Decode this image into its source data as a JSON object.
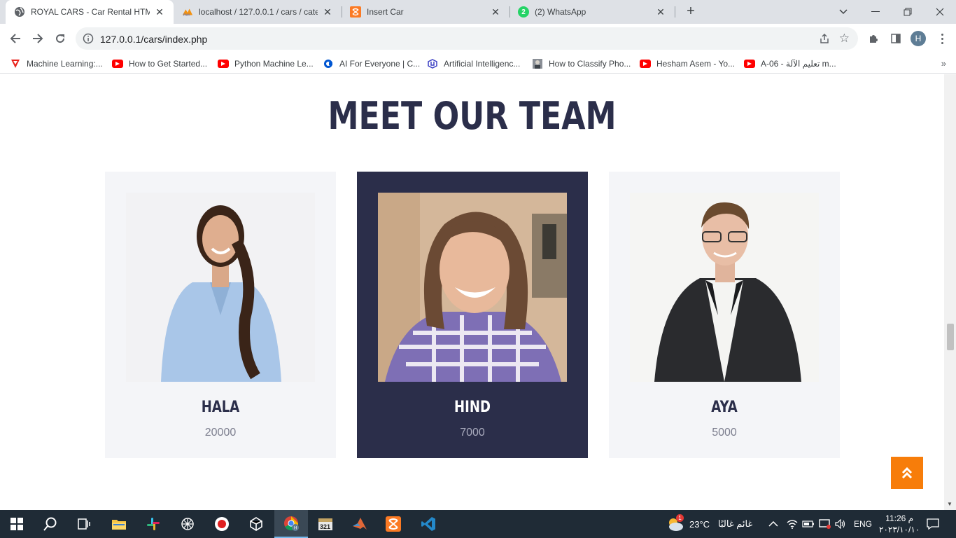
{
  "browser": {
    "tabs": [
      {
        "title": "ROYAL CARS - Car Rental HTML",
        "active": true
      },
      {
        "title": "localhost / 127.0.0.1 / cars / cate",
        "active": false
      },
      {
        "title": "Insert Car",
        "active": false
      },
      {
        "title": "(2) WhatsApp",
        "active": false
      }
    ],
    "whatsapp_badge": "2",
    "new_tab": "+",
    "url": "127.0.0.1/cars/index.php",
    "profile_initial": "H",
    "bookmarks": [
      {
        "label": "Machine Learning:...",
        "icon": "tensorflow-icon"
      },
      {
        "label": "How to Get Started...",
        "icon": "youtube-icon"
      },
      {
        "label": "Python Machine Le...",
        "icon": "youtube-icon"
      },
      {
        "label": "AI For Everyone | C...",
        "icon": "coursera-icon"
      },
      {
        "label": "Artificial Intelligenc...",
        "icon": "udacity-icon"
      },
      {
        "label": "How to Classify Pho...",
        "icon": "thumbnail-icon"
      },
      {
        "label": "Hesham Asem - Yo...",
        "icon": "youtube-icon"
      },
      {
        "label": "A-06 - تعليم الآلة m...",
        "icon": "youtube-icon"
      }
    ]
  },
  "page": {
    "title": "MEET OUR TEAM",
    "team": [
      {
        "name": "HALA",
        "salary": "20000",
        "highlight": false
      },
      {
        "name": "HIND",
        "salary": "7000",
        "highlight": true
      },
      {
        "name": "AYA",
        "salary": "5000",
        "highlight": false
      }
    ],
    "accent_color": "#f77d0a",
    "dark_color": "#2b2e4a"
  },
  "taskbar": {
    "weather_temp": "23°C",
    "weather_text": "غائم غالبًا",
    "weather_badge": "1",
    "language": "ENG",
    "time": "11:26 م",
    "date": "٢٠٢٣/١٠/١٠"
  }
}
